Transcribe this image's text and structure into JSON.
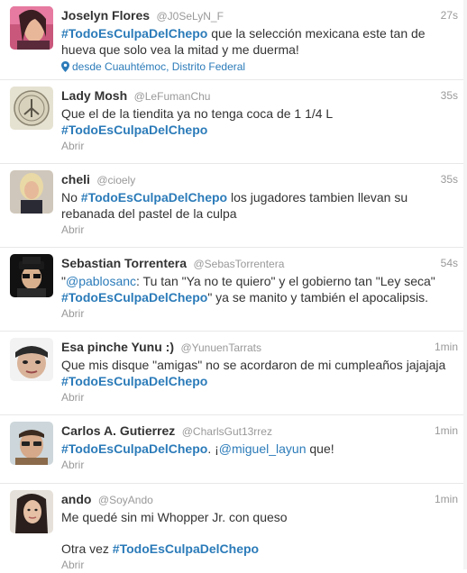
{
  "tweets": [
    {
      "name": "Joselyn Flores",
      "handle": "@J0SeLyN_F",
      "time": "27s",
      "parts": [
        {
          "t": "#TodoEsCulpaDelChepo",
          "k": "hashtag"
        },
        {
          "t": " que la selección mexicana este tan de hueva que solo vea la mitad y me duerma!",
          "k": "text"
        }
      ],
      "location": "desde Cuauhtémoc, Distrito Federal"
    },
    {
      "name": "Lady Mosh",
      "handle": "@LeFumanChu",
      "time": "35s",
      "parts": [
        {
          "t": "Que el de la tiendita ya no tenga coca de 1 1/4 L",
          "k": "text"
        },
        {
          "t": "",
          "k": "br"
        },
        {
          "t": "#TodoEsCulpaDelChepo",
          "k": "hashtag"
        }
      ],
      "action": "Abrir"
    },
    {
      "name": "cheli",
      "handle": "@cioely",
      "time": "35s",
      "parts": [
        {
          "t": "No ",
          "k": "text"
        },
        {
          "t": "#TodoEsCulpaDelChepo",
          "k": "hashtag"
        },
        {
          "t": " los jugadores tambien llevan su rebanada del pastel de la culpa",
          "k": "text"
        }
      ],
      "action": "Abrir"
    },
    {
      "name": "Sebastian Torrentera",
      "handle": "@SebasTorrentera",
      "time": "54s",
      "parts": [
        {
          "t": "\"",
          "k": "text"
        },
        {
          "t": "@pablosanc",
          "k": "mention"
        },
        {
          "t": ": Tu tan \"Ya no te quiero\" y el gobierno tan \"Ley seca\" ",
          "k": "text"
        },
        {
          "t": "#TodoEsCulpaDelChepo",
          "k": "hashtag"
        },
        {
          "t": "\" ya se manito y también el apocalipsis.",
          "k": "text"
        }
      ],
      "action": "Abrir"
    },
    {
      "name": "Esa pinche Yunu :)",
      "handle": "@YunuenTarrats",
      "time": "1min",
      "parts": [
        {
          "t": "Que mis disque \"amigas\" no se acordaron de mi cumpleaños jajajaja",
          "k": "text"
        },
        {
          "t": "",
          "k": "br"
        },
        {
          "t": "#TodoEsCulpaDelChepo",
          "k": "hashtag"
        }
      ],
      "action": "Abrir"
    },
    {
      "name": "Carlos A. Gutierrez",
      "handle": "@CharlsGut13rrez",
      "time": "1min",
      "parts": [
        {
          "t": "#TodoEsCulpaDelChepo",
          "k": "hashtag"
        },
        {
          "t": ". ¡",
          "k": "text"
        },
        {
          "t": "@miguel_layun",
          "k": "mention"
        },
        {
          "t": " que!",
          "k": "text"
        }
      ],
      "action": "Abrir"
    },
    {
      "name": "ando",
      "handle": "@SoyAndo",
      "time": "1min",
      "parts": [
        {
          "t": "Me quedé sin mi Whopper Jr. con queso",
          "k": "text"
        },
        {
          "t": "",
          "k": "br"
        },
        {
          "t": "",
          "k": "gap"
        },
        {
          "t": "Otra vez ",
          "k": "text"
        },
        {
          "t": "#TodoEsCulpaDelChepo",
          "k": "hashtag"
        }
      ],
      "action": "Abrir"
    }
  ]
}
